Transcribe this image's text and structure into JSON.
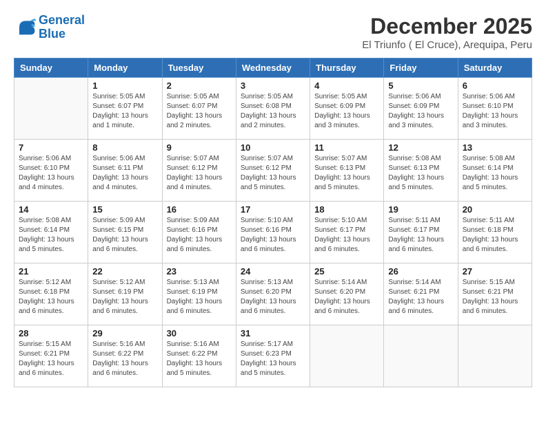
{
  "header": {
    "logo_line1": "General",
    "logo_line2": "Blue",
    "title": "December 2025",
    "subtitle": "El Triunfo ( El Cruce), Arequipa, Peru"
  },
  "calendar": {
    "days_of_week": [
      "Sunday",
      "Monday",
      "Tuesday",
      "Wednesday",
      "Thursday",
      "Friday",
      "Saturday"
    ],
    "weeks": [
      [
        {
          "day": "",
          "sunrise": "",
          "sunset": "",
          "daylight": ""
        },
        {
          "day": "1",
          "sunrise": "Sunrise: 5:05 AM",
          "sunset": "Sunset: 6:07 PM",
          "daylight": "Daylight: 13 hours and 1 minute."
        },
        {
          "day": "2",
          "sunrise": "Sunrise: 5:05 AM",
          "sunset": "Sunset: 6:07 PM",
          "daylight": "Daylight: 13 hours and 2 minutes."
        },
        {
          "day": "3",
          "sunrise": "Sunrise: 5:05 AM",
          "sunset": "Sunset: 6:08 PM",
          "daylight": "Daylight: 13 hours and 2 minutes."
        },
        {
          "day": "4",
          "sunrise": "Sunrise: 5:05 AM",
          "sunset": "Sunset: 6:09 PM",
          "daylight": "Daylight: 13 hours and 3 minutes."
        },
        {
          "day": "5",
          "sunrise": "Sunrise: 5:06 AM",
          "sunset": "Sunset: 6:09 PM",
          "daylight": "Daylight: 13 hours and 3 minutes."
        },
        {
          "day": "6",
          "sunrise": "Sunrise: 5:06 AM",
          "sunset": "Sunset: 6:10 PM",
          "daylight": "Daylight: 13 hours and 3 minutes."
        }
      ],
      [
        {
          "day": "7",
          "sunrise": "Sunrise: 5:06 AM",
          "sunset": "Sunset: 6:10 PM",
          "daylight": "Daylight: 13 hours and 4 minutes."
        },
        {
          "day": "8",
          "sunrise": "Sunrise: 5:06 AM",
          "sunset": "Sunset: 6:11 PM",
          "daylight": "Daylight: 13 hours and 4 minutes."
        },
        {
          "day": "9",
          "sunrise": "Sunrise: 5:07 AM",
          "sunset": "Sunset: 6:12 PM",
          "daylight": "Daylight: 13 hours and 4 minutes."
        },
        {
          "day": "10",
          "sunrise": "Sunrise: 5:07 AM",
          "sunset": "Sunset: 6:12 PM",
          "daylight": "Daylight: 13 hours and 5 minutes."
        },
        {
          "day": "11",
          "sunrise": "Sunrise: 5:07 AM",
          "sunset": "Sunset: 6:13 PM",
          "daylight": "Daylight: 13 hours and 5 minutes."
        },
        {
          "day": "12",
          "sunrise": "Sunrise: 5:08 AM",
          "sunset": "Sunset: 6:13 PM",
          "daylight": "Daylight: 13 hours and 5 minutes."
        },
        {
          "day": "13",
          "sunrise": "Sunrise: 5:08 AM",
          "sunset": "Sunset: 6:14 PM",
          "daylight": "Daylight: 13 hours and 5 minutes."
        }
      ],
      [
        {
          "day": "14",
          "sunrise": "Sunrise: 5:08 AM",
          "sunset": "Sunset: 6:14 PM",
          "daylight": "Daylight: 13 hours and 5 minutes."
        },
        {
          "day": "15",
          "sunrise": "Sunrise: 5:09 AM",
          "sunset": "Sunset: 6:15 PM",
          "daylight": "Daylight: 13 hours and 6 minutes."
        },
        {
          "day": "16",
          "sunrise": "Sunrise: 5:09 AM",
          "sunset": "Sunset: 6:16 PM",
          "daylight": "Daylight: 13 hours and 6 minutes."
        },
        {
          "day": "17",
          "sunrise": "Sunrise: 5:10 AM",
          "sunset": "Sunset: 6:16 PM",
          "daylight": "Daylight: 13 hours and 6 minutes."
        },
        {
          "day": "18",
          "sunrise": "Sunrise: 5:10 AM",
          "sunset": "Sunset: 6:17 PM",
          "daylight": "Daylight: 13 hours and 6 minutes."
        },
        {
          "day": "19",
          "sunrise": "Sunrise: 5:11 AM",
          "sunset": "Sunset: 6:17 PM",
          "daylight": "Daylight: 13 hours and 6 minutes."
        },
        {
          "day": "20",
          "sunrise": "Sunrise: 5:11 AM",
          "sunset": "Sunset: 6:18 PM",
          "daylight": "Daylight: 13 hours and 6 minutes."
        }
      ],
      [
        {
          "day": "21",
          "sunrise": "Sunrise: 5:12 AM",
          "sunset": "Sunset: 6:18 PM",
          "daylight": "Daylight: 13 hours and 6 minutes."
        },
        {
          "day": "22",
          "sunrise": "Sunrise: 5:12 AM",
          "sunset": "Sunset: 6:19 PM",
          "daylight": "Daylight: 13 hours and 6 minutes."
        },
        {
          "day": "23",
          "sunrise": "Sunrise: 5:13 AM",
          "sunset": "Sunset: 6:19 PM",
          "daylight": "Daylight: 13 hours and 6 minutes."
        },
        {
          "day": "24",
          "sunrise": "Sunrise: 5:13 AM",
          "sunset": "Sunset: 6:20 PM",
          "daylight": "Daylight: 13 hours and 6 minutes."
        },
        {
          "day": "25",
          "sunrise": "Sunrise: 5:14 AM",
          "sunset": "Sunset: 6:20 PM",
          "daylight": "Daylight: 13 hours and 6 minutes."
        },
        {
          "day": "26",
          "sunrise": "Sunrise: 5:14 AM",
          "sunset": "Sunset: 6:21 PM",
          "daylight": "Daylight: 13 hours and 6 minutes."
        },
        {
          "day": "27",
          "sunrise": "Sunrise: 5:15 AM",
          "sunset": "Sunset: 6:21 PM",
          "daylight": "Daylight: 13 hours and 6 minutes."
        }
      ],
      [
        {
          "day": "28",
          "sunrise": "Sunrise: 5:15 AM",
          "sunset": "Sunset: 6:21 PM",
          "daylight": "Daylight: 13 hours and 6 minutes."
        },
        {
          "day": "29",
          "sunrise": "Sunrise: 5:16 AM",
          "sunset": "Sunset: 6:22 PM",
          "daylight": "Daylight: 13 hours and 6 minutes."
        },
        {
          "day": "30",
          "sunrise": "Sunrise: 5:16 AM",
          "sunset": "Sunset: 6:22 PM",
          "daylight": "Daylight: 13 hours and 5 minutes."
        },
        {
          "day": "31",
          "sunrise": "Sunrise: 5:17 AM",
          "sunset": "Sunset: 6:23 PM",
          "daylight": "Daylight: 13 hours and 5 minutes."
        },
        {
          "day": "",
          "sunrise": "",
          "sunset": "",
          "daylight": ""
        },
        {
          "day": "",
          "sunrise": "",
          "sunset": "",
          "daylight": ""
        },
        {
          "day": "",
          "sunrise": "",
          "sunset": "",
          "daylight": ""
        }
      ]
    ]
  }
}
